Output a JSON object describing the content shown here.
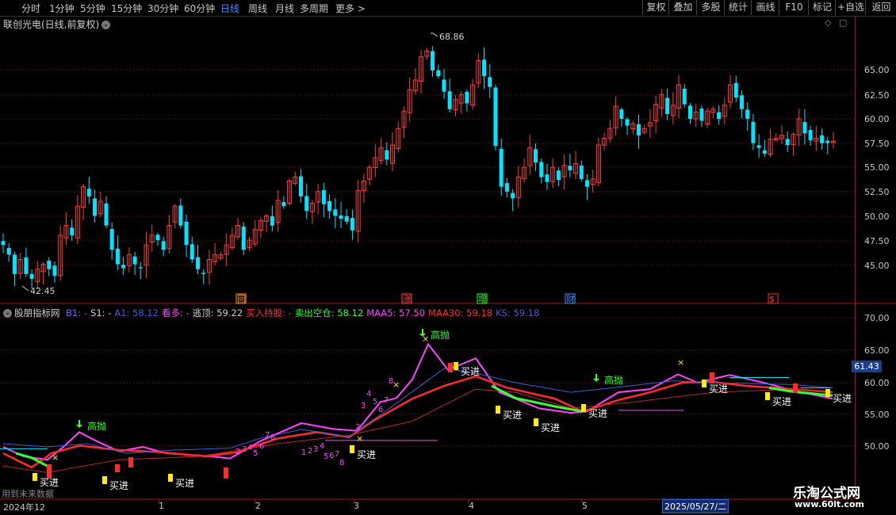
{
  "toolbar": {
    "periods": [
      "分时",
      "1分钟",
      "5分钟",
      "15分钟",
      "30分钟",
      "60分钟",
      "日线",
      "周线",
      "月线",
      "多周期",
      "更多"
    ],
    "active_period": "日线",
    "buttons": [
      "复权",
      "叠加",
      "多股",
      "统计",
      "画线",
      "F10",
      "标记",
      "+自选",
      "返回"
    ]
  },
  "stock": {
    "title": "联创光电(日线,前复权)"
  },
  "price_axis": [
    "65.00",
    "62.50",
    "60.00",
    "57.50",
    "55.00",
    "52.50",
    "50.00",
    "47.50",
    "45.00"
  ],
  "price_high": "68.86",
  "price_low": "42.45",
  "event_markers": [
    "回",
    "涨",
    "增",
    "财",
    "$"
  ],
  "indicator": {
    "name": "股朋指标网",
    "items": [
      {
        "label": "B1: -",
        "color": "#6a6aff"
      },
      {
        "label": "S1: -",
        "color": "#d0d0d0"
      },
      {
        "label": "A1: 58.12",
        "color": "#3d5fd6"
      },
      {
        "label": "看多: -",
        "color": "#ff44ff"
      },
      {
        "label": "逃顶: 59.22",
        "color": "#d0d0d0"
      },
      {
        "label": "买入持股: -",
        "color": "#ff3030"
      },
      {
        "label": "卖出空仓: 58.12",
        "color": "#33ff33"
      },
      {
        "label": "MAA5: 57.50",
        "color": "#ff44ff"
      },
      {
        "label": "MAA30: 59.18",
        "color": "#ff3030"
      },
      {
        "label": "KS: 59.18",
        "color": "#3d5fd6"
      }
    ]
  },
  "indicator_axis": [
    "70.00",
    "65.00",
    "60.00",
    "55.00",
    "50.00"
  ],
  "current_value": "61.43",
  "signals": {
    "buy": "买进",
    "sell": "高抛"
  },
  "date_axis": [
    "2024年12",
    "1",
    "2",
    "3",
    "4",
    "5"
  ],
  "current_date": "2025/05/27/二",
  "footer_note": "用到未来数据",
  "watermark": {
    "cn": "乐淘公式网",
    "url": "www.60lt.com"
  },
  "colors": {
    "up": "#ff3b3b",
    "down": "#00e5ff",
    "grid": "#8b1a1a"
  }
}
